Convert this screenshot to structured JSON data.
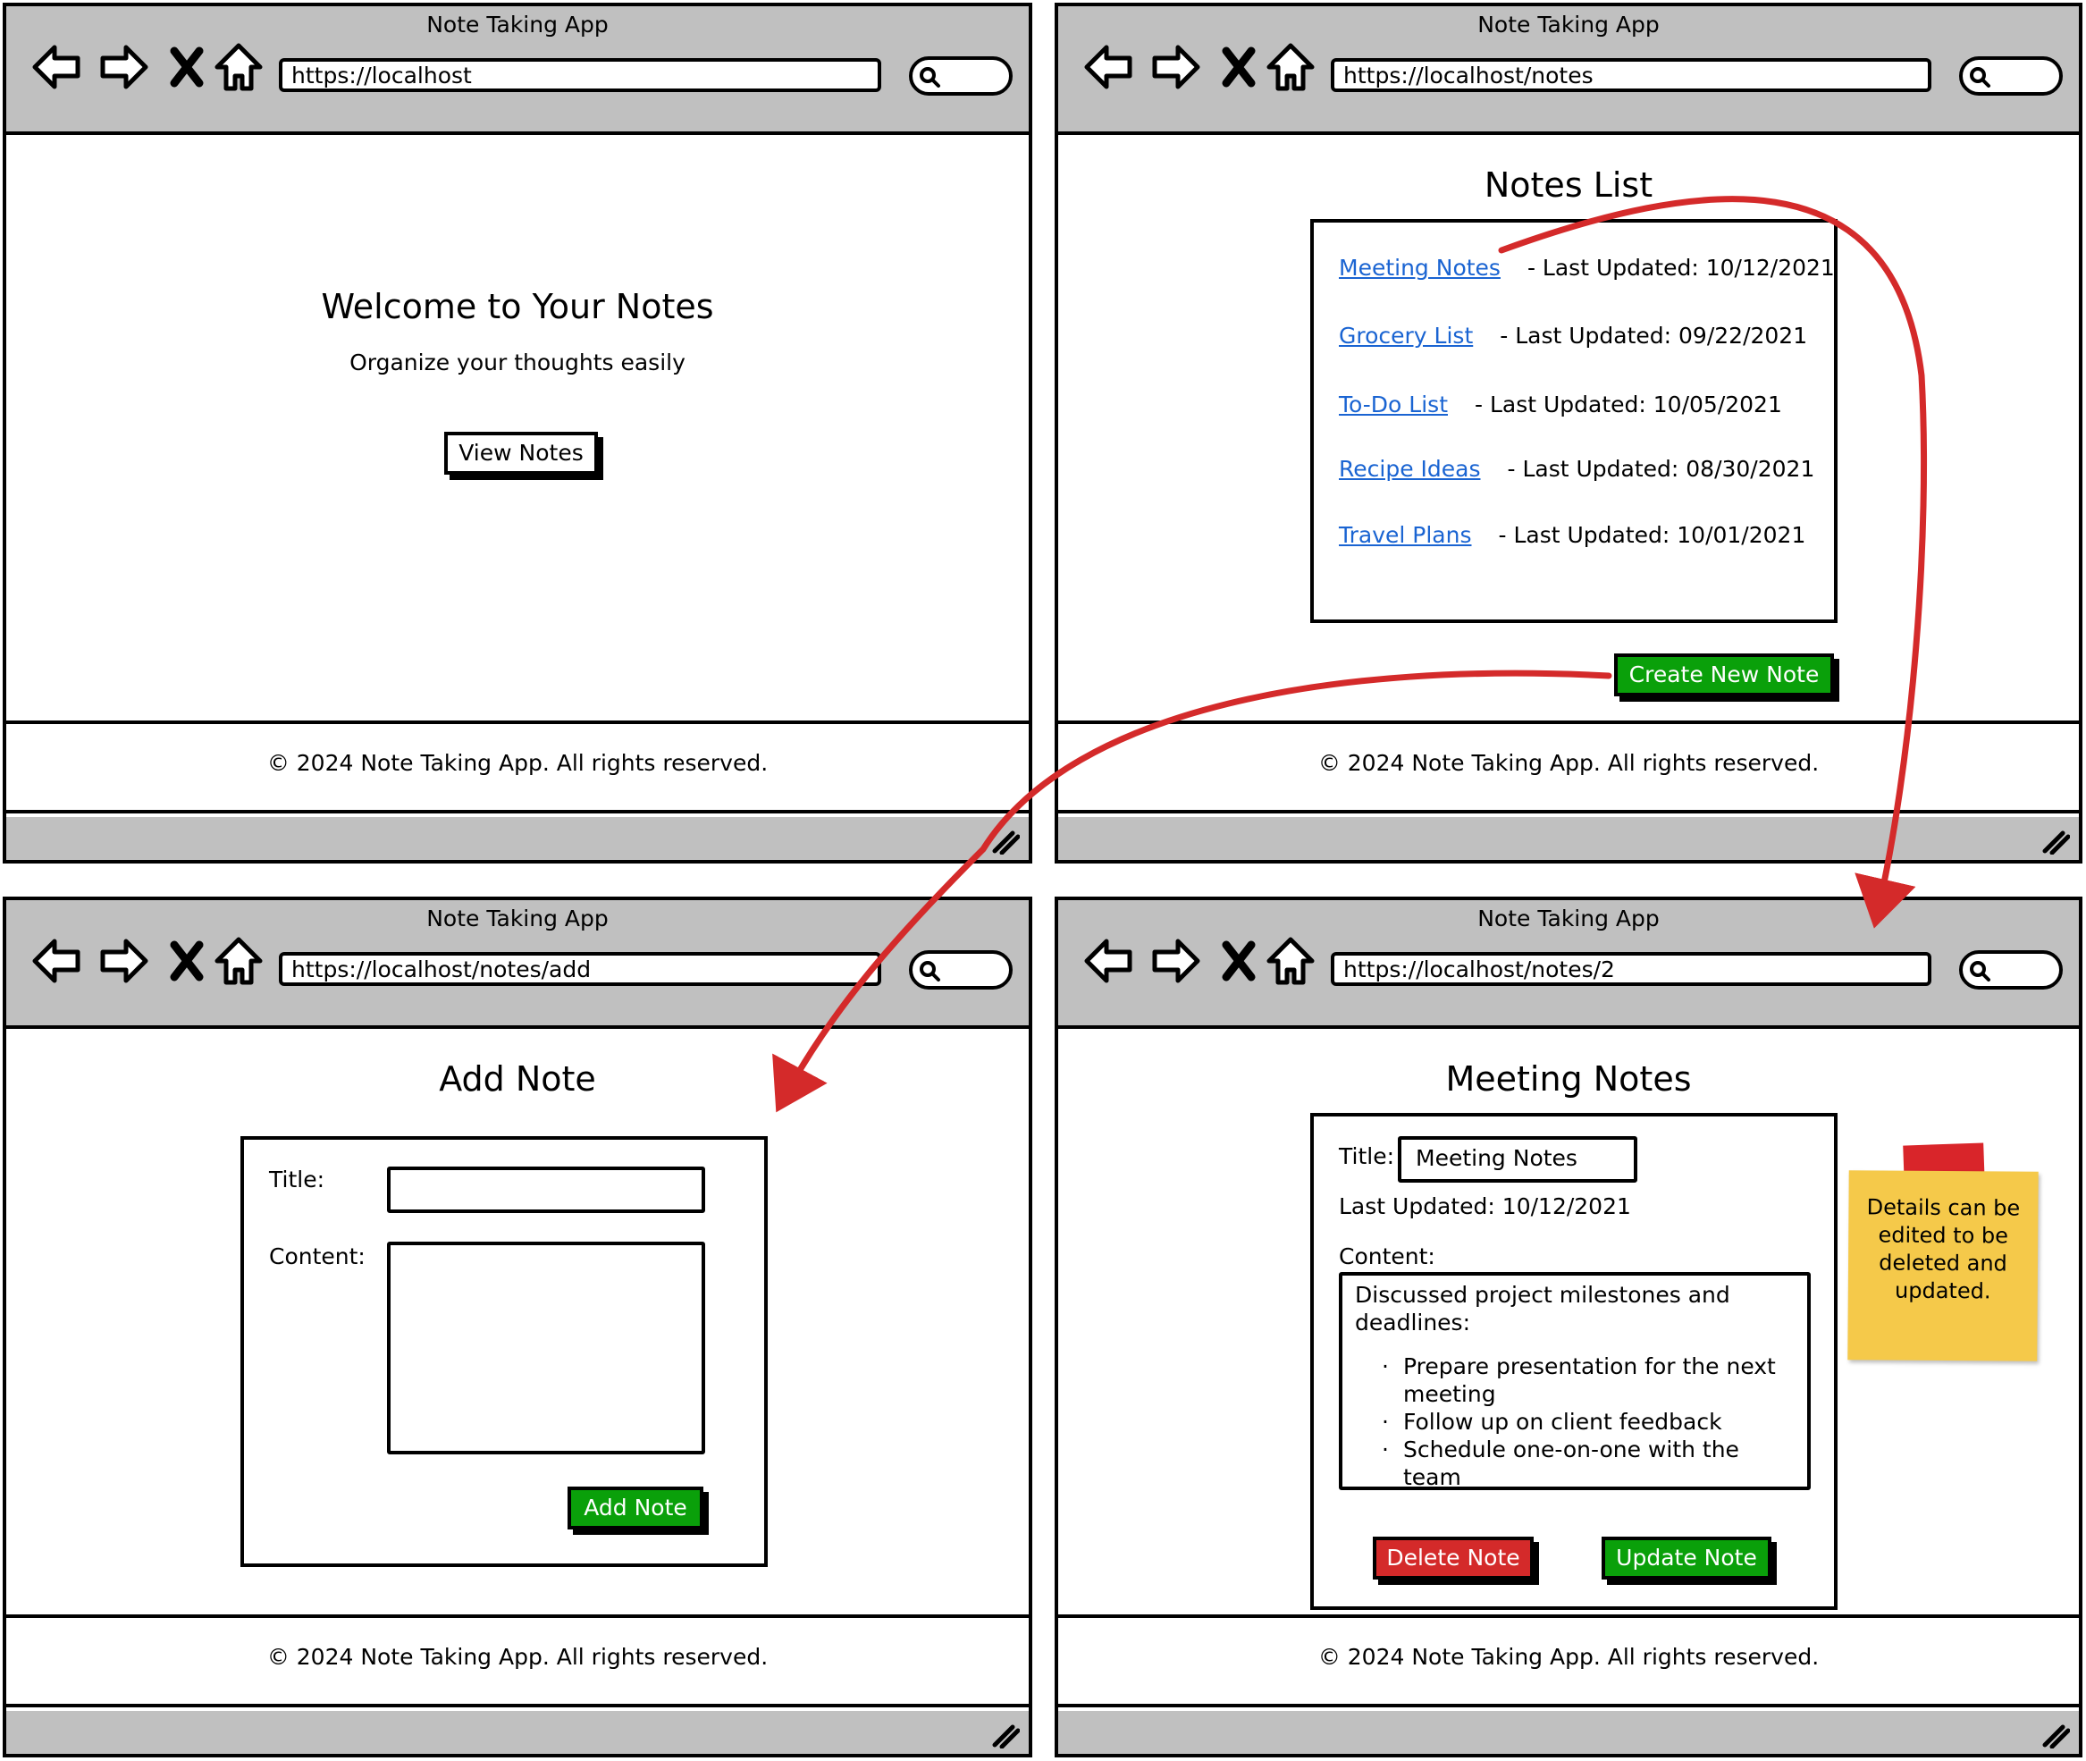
{
  "app_title": "Note Taking App",
  "footer_text": "© 2024 Note Taking App. All rights reserved.",
  "colors": {
    "link": "#1a64d2",
    "green_button": "#0aa00a",
    "red_button": "#d42a2a",
    "arrow": "#d42a2a",
    "sticky": "#f5c94a",
    "chrome": "#c0c0c0"
  },
  "screens": {
    "home": {
      "url": "https://localhost",
      "heading": "Welcome to Your Notes",
      "subheading": "Organize your thoughts easily",
      "view_button": "View Notes"
    },
    "list": {
      "url": "https://localhost/notes",
      "heading": "Notes List",
      "notes": [
        {
          "title": "Meeting Notes",
          "updated": "- Last Updated: 10/12/2021"
        },
        {
          "title": "Grocery List",
          "updated": "- Last Updated: 09/22/2021"
        },
        {
          "title": "To-Do List",
          "updated": "- Last Updated: 10/05/2021"
        },
        {
          "title": "Recipe Ideas",
          "updated": "- Last Updated: 08/30/2021"
        },
        {
          "title": "Travel Plans",
          "updated": "- Last Updated: 10/01/2021"
        }
      ],
      "create_button": "Create New Note"
    },
    "add": {
      "url": "https://localhost/notes/add",
      "heading": "Add Note",
      "title_label": "Title:",
      "content_label": "Content:",
      "add_button": "Add Note"
    },
    "detail": {
      "url": "https://localhost/notes/2",
      "heading": "Meeting Notes",
      "title_label": "Title:",
      "title_value": "Meeting Notes",
      "last_updated": "Last Updated: 10/12/2021",
      "content_label": "Content:",
      "content_intro": "Discussed project milestones and deadlines:",
      "content_items": [
        "Prepare presentation for the next meeting",
        "Follow up on client feedback",
        "Schedule one-on-one with the team"
      ],
      "delete_button": "Delete Note",
      "update_button": "Update Note"
    }
  },
  "sticky_note": "Details can be edited to be deleted and updated."
}
